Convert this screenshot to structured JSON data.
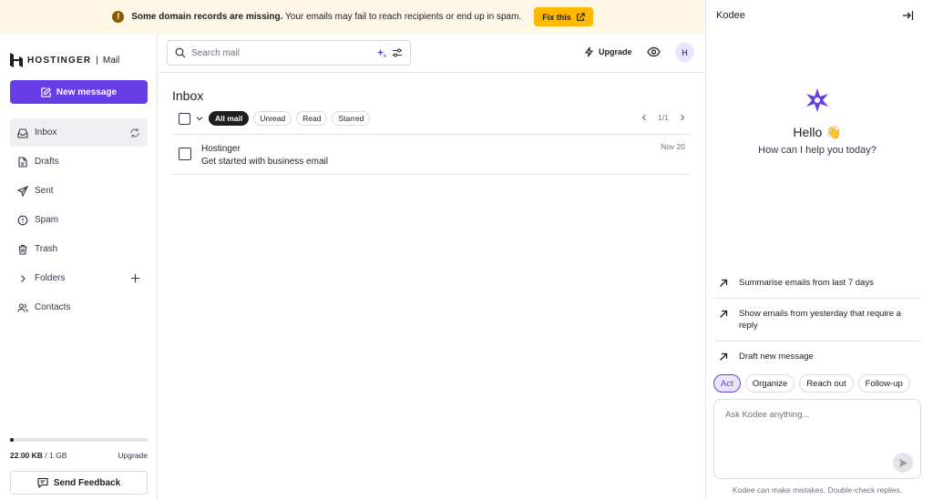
{
  "banner": {
    "bold_text": "Some domain records are missing.",
    "text": " Your emails may fail to reach recipients or end up in spam.",
    "fix_label": "Fix this"
  },
  "sidebar": {
    "brand": "HOSTINGER",
    "separator": "|",
    "product": "Mail",
    "new_message": "New message",
    "items": [
      {
        "label": "Inbox",
        "icon": "inbox-icon"
      },
      {
        "label": "Drafts",
        "icon": "drafts-icon"
      },
      {
        "label": "Sent",
        "icon": "sent-icon"
      },
      {
        "label": "Spam",
        "icon": "spam-icon"
      },
      {
        "label": "Trash",
        "icon": "trash-icon"
      },
      {
        "label": "Folders",
        "icon": "chevron-right-icon"
      },
      {
        "label": "Contacts",
        "icon": "contacts-icon"
      }
    ],
    "storage": {
      "used": "22.00 KB",
      "total": " / 1 GB",
      "fraction": 0.02,
      "upgrade": "Upgrade"
    },
    "feedback": "Send Feedback"
  },
  "header": {
    "search_placeholder": "Search mail",
    "upgrade": "Upgrade",
    "avatar_initial": "H"
  },
  "inbox": {
    "title": "Inbox",
    "filters": [
      "All mail",
      "Unread",
      "Read",
      "Starred"
    ],
    "pager": "1/1",
    "messages": [
      {
        "sender": "Hostinger",
        "subject": "Get started with business email",
        "date": "Nov 20"
      }
    ]
  },
  "kodee": {
    "title": "Kodee",
    "hello": "Hello 👋",
    "subtitle": "How can I help you today?",
    "suggestions": [
      "Summarise emails from last 7 days",
      "Show emails from yesterday that require a reply",
      "Draft new message"
    ],
    "chips": [
      "Act",
      "Organize",
      "Reach out",
      "Follow-up"
    ],
    "ask_placeholder": "Ask Kodee anything...",
    "disclaimer": "Kodee can make mistakes. Double-check replies."
  },
  "colors": {
    "accent": "#673de6",
    "warning": "#ffb800",
    "banner_bg": "#fef6e6"
  }
}
